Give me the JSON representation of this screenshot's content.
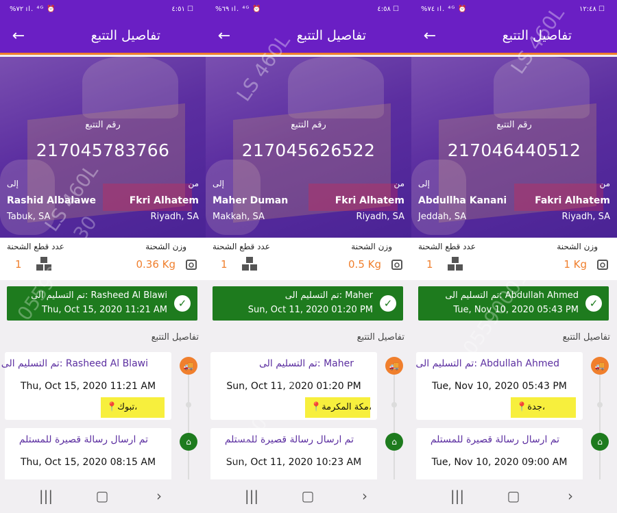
{
  "panels": [
    {
      "status_bar": {
        "left": "%٧٢ ‎ıl. ⁴ᴳ ⏰",
        "right": "٤:٥١ ☐"
      },
      "app_bar": {
        "title": "تفاصيل التتبع"
      },
      "hero": {
        "number_label": "رقم التتبع",
        "tracking_number": "217045783766",
        "from_label": "من",
        "to_label": "إلى",
        "from_name": "Fkri Alhatem",
        "from_city": "Riyadh, SA",
        "to_name": "Rashid Albalawe",
        "to_city": "Tabuk, SA"
      },
      "info": {
        "weight_label": "وزن الشحنة",
        "weight_value": "0.36 Kg",
        "pieces_label": "عدد قطع الشحنة",
        "pieces_value": "1"
      },
      "status": {
        "line1": "تم التسليم الى: Rasheed Al Blawi",
        "line2": "Thu, Oct 15, 2020 11:21 AM"
      },
      "section_title": "تفاصيل التتبع",
      "events": [
        {
          "title": "تم التسليم الى: Rasheed Al Blawi",
          "date": "Thu, Oct 15, 2020 11:21 AM",
          "location": "تبوك،"
        },
        {
          "title": "تم ارسال رسالة قصيرة للمستلم",
          "date": "Thu, Oct 15, 2020 08:15 AM"
        }
      ]
    },
    {
      "status_bar": {
        "left": "%٦٩ ‎ıl. ⁴ᴳ ⏰",
        "right": "٤:٥٨ ☐"
      },
      "app_bar": {
        "title": "تفاصيل التتبع"
      },
      "hero": {
        "number_label": "رقم التتبع",
        "tracking_number": "217045626522",
        "from_label": "من",
        "to_label": "إلى",
        "from_name": "Fkri Alhatem",
        "from_city": "Riyadh, SA",
        "to_name": "Maher Duman",
        "to_city": "Makkah, SA"
      },
      "info": {
        "weight_label": "وزن الشحنة",
        "weight_value": "0.5 Kg",
        "pieces_label": "عدد قطع الشحنة",
        "pieces_value": "1"
      },
      "status": {
        "line1": "تم التسليم الى: Maher",
        "line2": "Sun, Oct 11, 2020 01:20 PM"
      },
      "section_title": "تفاصيل التتبع",
      "events": [
        {
          "title": "تم التسليم الى: Maher",
          "date": "Sun, Oct 11, 2020 01:20 PM",
          "location": "مكة المكرمة،"
        },
        {
          "title": "تم ارسال رسالة قصيرة للمستلم",
          "date": "Sun, Oct 11, 2020 10:23 AM"
        }
      ]
    },
    {
      "status_bar": {
        "left": "%٧٤ ‎ıl. ⁴ᴳ ⏰",
        "right": "١٢:٤٨ ☐"
      },
      "app_bar": {
        "title": "تفاصيل التتبع"
      },
      "hero": {
        "number_label": "رقم التتبع",
        "tracking_number": "217046440512",
        "from_label": "من",
        "to_label": "إلى",
        "from_name": "Fakri Alhatem",
        "from_city": "Riyadh, SA",
        "to_name": "Abdullha Kanani",
        "to_city": "Jeddah, SA"
      },
      "info": {
        "weight_label": "وزن الشحنة",
        "weight_value": "1 Kg",
        "pieces_label": "عدد قطع الشحنة",
        "pieces_value": "1"
      },
      "status": {
        "line1": "تم التسليم الى: Abdullah Ahmed",
        "line2": "Tue, Nov 10, 2020 05:43 PM"
      },
      "section_title": "تفاصيل التتبع",
      "events": [
        {
          "title": "تم التسليم الى: Abdullah Ahmed",
          "date": "Tue, Nov 10, 2020 05:43 PM",
          "location": "جدة،"
        },
        {
          "title": "تم ارسال رسالة قصيرة للمستلم",
          "date": "Tue, Nov 10, 2020 09:00 AM"
        }
      ]
    }
  ],
  "watermark": {
    "model": "LS 460L",
    "phone": "0559000130"
  },
  "nav": {
    "recent_icon": "recent-apps-icon",
    "home_icon": "home-icon",
    "back_icon": "back-icon"
  },
  "colors": {
    "app_bar": "#6a1fc4",
    "accent_orange": "#f07f2d",
    "delivered_green": "#1e7b1e",
    "location_highlight": "#f7ef3d"
  }
}
